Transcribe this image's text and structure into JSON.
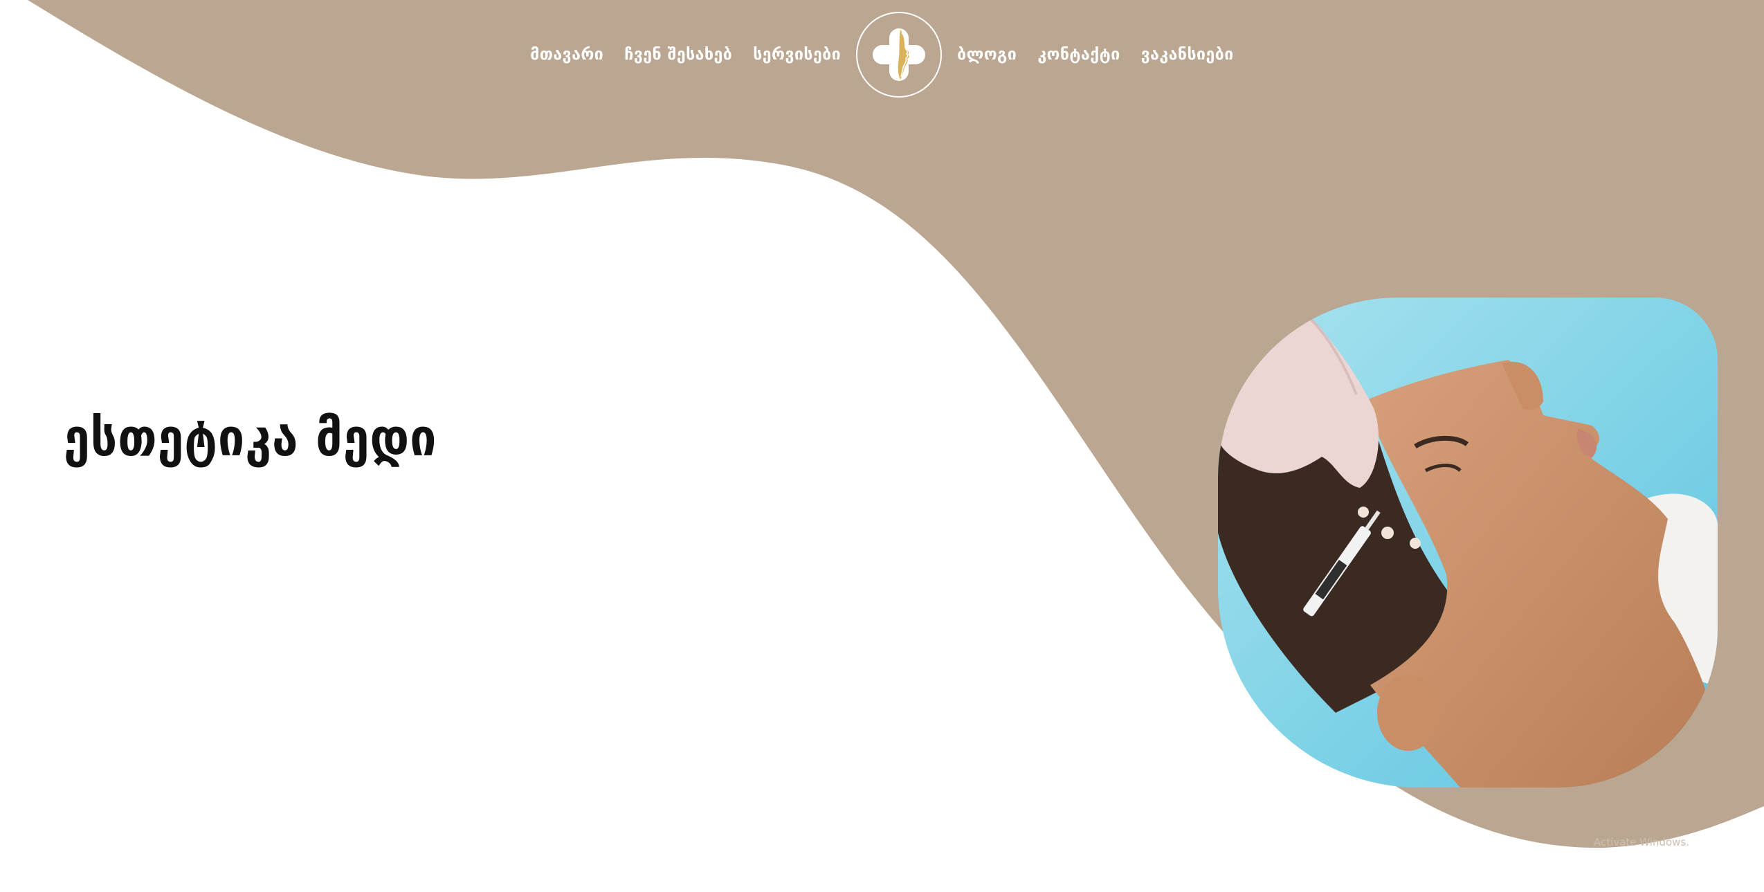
{
  "colors": {
    "brand_tan": "#baa691",
    "background": "#ffffff",
    "title": "#111111",
    "nav_text": "#ffffff"
  },
  "nav": {
    "left_items": [
      {
        "label": "მთავარი"
      },
      {
        "label": "ჩვენ შესახებ"
      },
      {
        "label": "სერვისები"
      }
    ],
    "right_items": [
      {
        "label": "ბლოგი"
      },
      {
        "label": "კონტაქტი"
      },
      {
        "label": "ვაკანსიები"
      }
    ],
    "logo_icon": "cross-face-logo-icon"
  },
  "hero": {
    "title": "ესთეტიკა მედი",
    "image_icon": "facial-injection-photo"
  },
  "watermark": {
    "text": "Activate Windows."
  }
}
